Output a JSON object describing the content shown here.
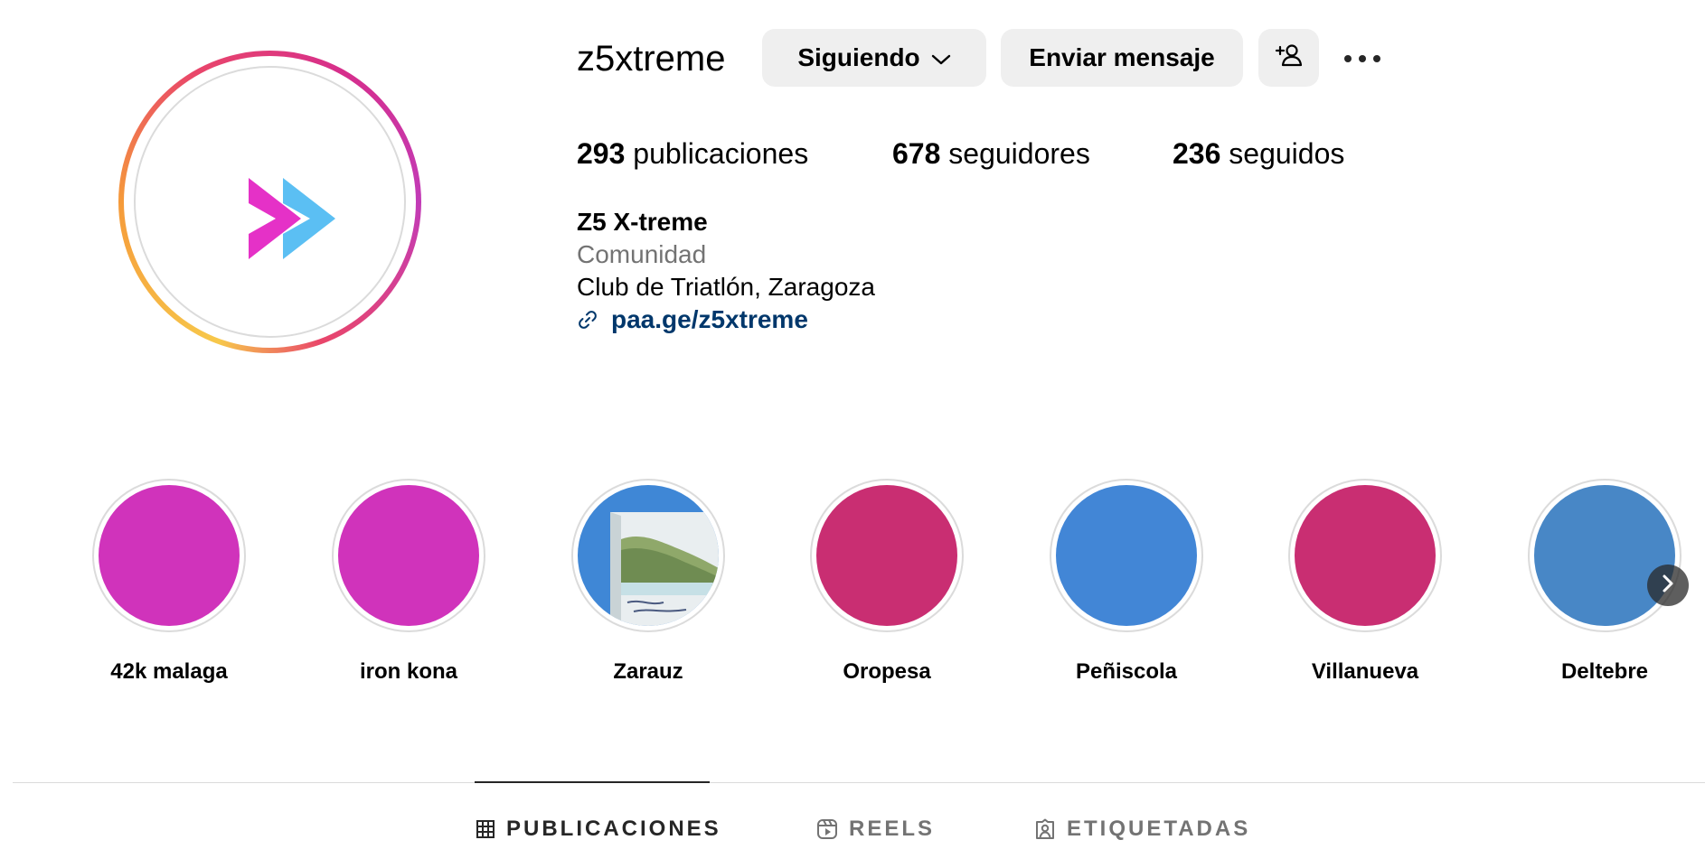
{
  "profile": {
    "username": "z5xtreme",
    "avatar_icon": "double-chevron-logo"
  },
  "actions": {
    "following_label": "Siguiendo",
    "message_label": "Enviar mensaje",
    "add_user_icon": "add-user-icon",
    "more_icon": "more-options-icon"
  },
  "stats": {
    "posts_count": "293",
    "posts_label": "publicaciones",
    "followers_count": "678",
    "followers_label": "seguidores",
    "following_count": "236",
    "following_label": "seguidos"
  },
  "bio": {
    "name": "Z5 X-treme",
    "category": "Comunidad",
    "description": "Club de Triatlón, Zaragoza",
    "link": "paa.ge/z5xtreme"
  },
  "highlights": [
    {
      "label": "42k malaga",
      "color": "#d033bb"
    },
    {
      "label": "iron kona",
      "color": "#d033bb"
    },
    {
      "label": "Zarauz",
      "color": "#3f87d6"
    },
    {
      "label": "Oropesa",
      "color": "#c92e72"
    },
    {
      "label": "Peñiscola",
      "color": "#4286d6"
    },
    {
      "label": "Villanueva",
      "color": "#c92e72"
    },
    {
      "label": "Deltebre",
      "color": "#4887c6"
    }
  ],
  "tabs": [
    {
      "label": "PUBLICACIONES",
      "icon": "grid-icon",
      "active": true
    },
    {
      "label": "REELS",
      "icon": "reels-icon",
      "active": false
    },
    {
      "label": "ETIQUETADAS",
      "icon": "tagged-icon",
      "active": false
    }
  ],
  "colors": {
    "brand_pink": "#e531c7",
    "brand_blue": "#5bbff3",
    "link": "#00376b",
    "muted": "#737373"
  }
}
